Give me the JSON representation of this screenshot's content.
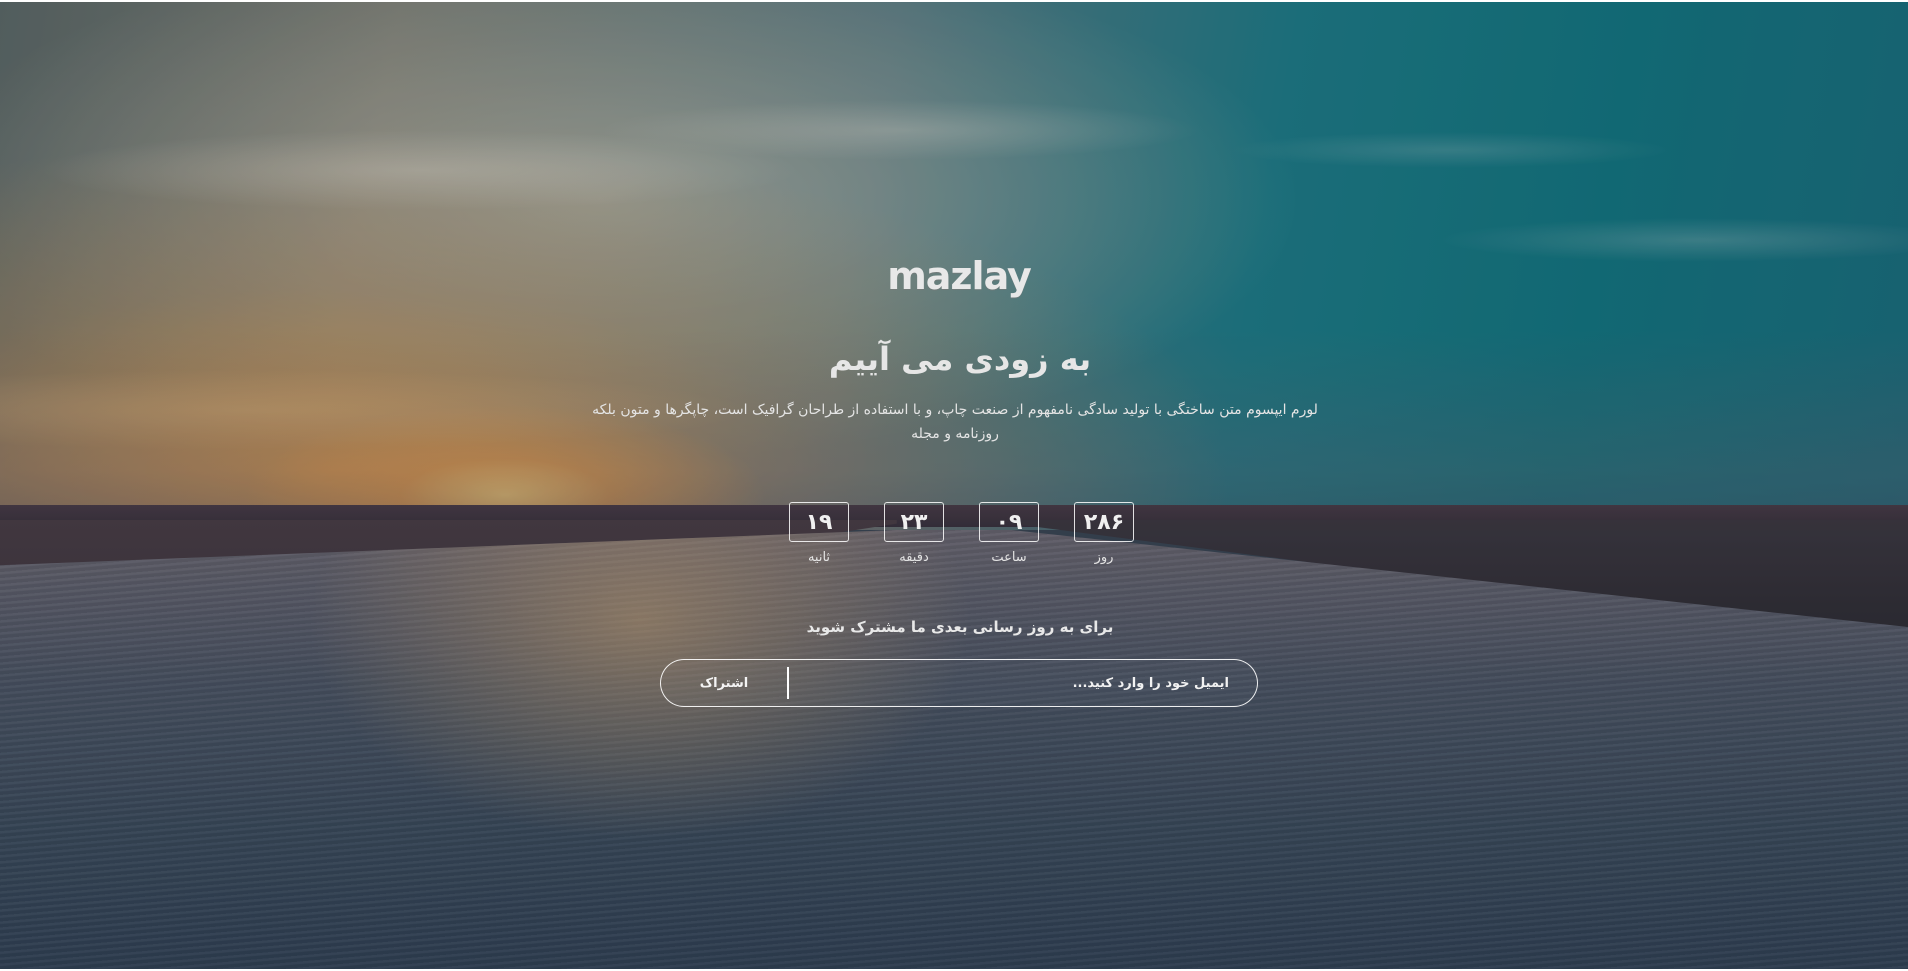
{
  "brand": {
    "logo_text": "mazlay"
  },
  "hero": {
    "headline": "به زودی می آییم",
    "description": "لورم ایپسوم متن ساختگی با تولید سادگی نامفهوم از صنعت چاپ، و با استفاده از طراحان گرافیک است، چاپگرها و متون بلکه روزنامه و مجله"
  },
  "countdown": {
    "units": [
      {
        "value": "۲۸۶",
        "label": "روز"
      },
      {
        "value": "۰۹",
        "label": "ساعت"
      },
      {
        "value": "۲۳",
        "label": "دقیقه"
      },
      {
        "value": "۱۹",
        "label": "ثانیه"
      }
    ]
  },
  "subscribe": {
    "title": "برای به روز رسانی بعدی ما مشترک شوید",
    "email_placeholder": "ایمیل خود را وارد کنید...",
    "button_label": "اشتراک"
  },
  "colors": {
    "text": "#e9e9e9",
    "border": "#ffffff"
  }
}
